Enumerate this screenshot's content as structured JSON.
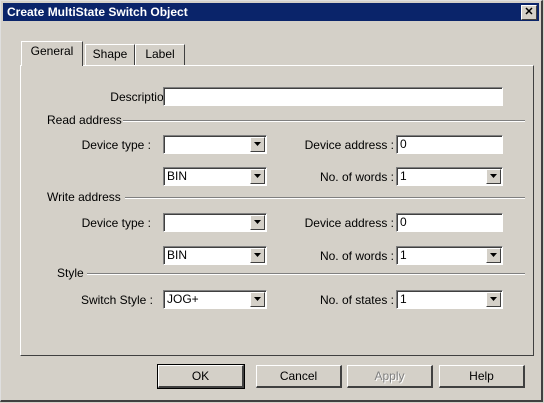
{
  "dialog": {
    "title": "Create MultiState Switch Object"
  },
  "tabs": [
    {
      "label": "General",
      "active": true
    },
    {
      "label": "Shape",
      "active": false
    },
    {
      "label": "Label",
      "active": false
    }
  ],
  "general": {
    "description_label": "Description :",
    "description_value": "",
    "read": {
      "group_label": "Read address",
      "device_type_label": "Device type :",
      "device_type_value": "",
      "format_value": "BIN",
      "device_address_label": "Device address :",
      "device_address_value": "0",
      "words_label": "No. of words :",
      "words_value": "1"
    },
    "write": {
      "group_label": "Write address",
      "device_type_label": "Device type :",
      "device_type_value": "",
      "format_value": "BIN",
      "device_address_label": "Device  address :",
      "device_address_value": "0",
      "words_label": "No. of words :",
      "words_value": "1"
    },
    "style": {
      "group_label": "Style",
      "switch_style_label": "Switch Style :",
      "switch_style_value": "JOG+",
      "states_label": "No. of states :",
      "states_value": "1"
    }
  },
  "buttons": {
    "ok": "OK",
    "cancel": "Cancel",
    "apply": "Apply",
    "help": "Help"
  }
}
